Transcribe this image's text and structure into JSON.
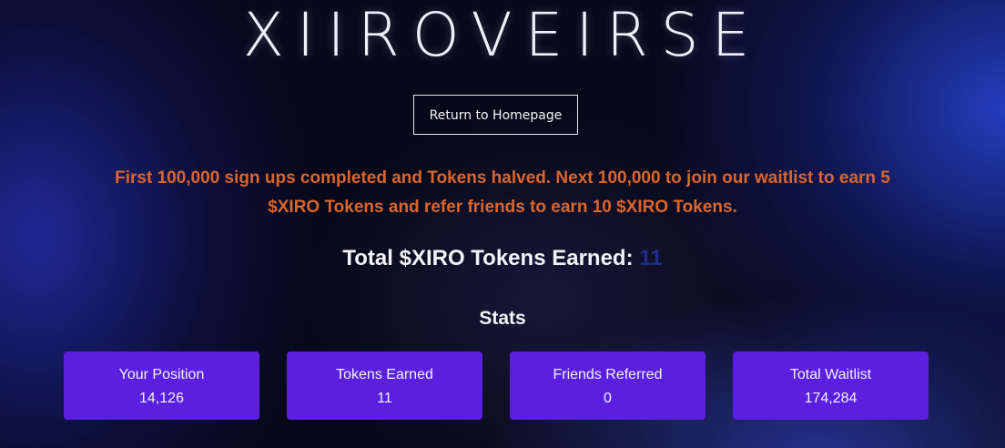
{
  "brand": {
    "logo_text": "XIIROVEIRSE"
  },
  "header": {
    "return_button_label": "Return to Homepage"
  },
  "notice": {
    "line1": "First 100,000 sign ups completed and Tokens halved. Next 100,000 to join our waitlist to earn 5",
    "line2": "$XIRO Tokens and refer friends to earn 10 $XIRO Tokens.",
    "color": "#d9662d"
  },
  "total": {
    "label": "Total $XIRO Tokens Earned:",
    "value": "11",
    "value_color": "#1f2c8a"
  },
  "stats": {
    "heading": "Stats",
    "card_color": "#5b1fe0",
    "items": [
      {
        "label": "Your Position",
        "value": "14,126"
      },
      {
        "label": "Tokens Earned",
        "value": "11"
      },
      {
        "label": "Friends Referred",
        "value": "0"
      },
      {
        "label": "Total Waitlist",
        "value": "174,284"
      }
    ]
  }
}
